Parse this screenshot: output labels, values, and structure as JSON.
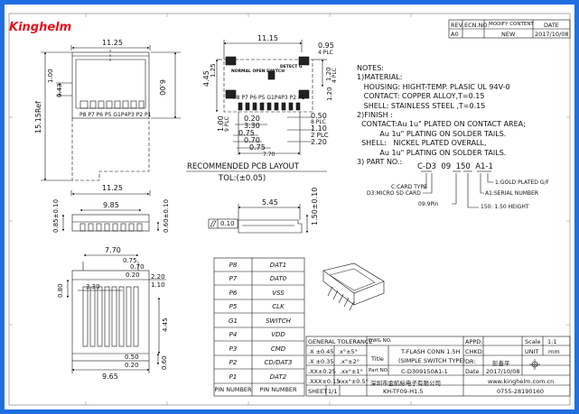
{
  "brand": {
    "logo": "Kinghelm"
  },
  "rev_table": {
    "headers": [
      "REV.",
      "ECN.NO.",
      "MODIFY CONTENT",
      "DATE"
    ],
    "row": [
      "A0",
      "",
      "NEW",
      "2017/10/08"
    ]
  },
  "dims": {
    "top_width": "11.25",
    "top_height": "6.00",
    "top_d1": "1.00",
    "top_d2": "0.43",
    "ref": "15.15Ref",
    "top_pins": "P8 P7 P6 P5 G1P4P3 P2 P1",
    "front_w1": "11.25",
    "front_w2": "9.85",
    "front_h1": "0.85±0.10",
    "front_h2": "0.60±0.10",
    "bot_w1": "7.70",
    "bot_d1": "0.75",
    "bot_d2": "0.70",
    "bot_d3": "0.20",
    "bot_d4": "2.20",
    "bot_d5": "1.10",
    "bot_d6": "3.30",
    "bot_d7": "0.80",
    "bot_d8": "4.45",
    "bot_d9": "0.50",
    "bot_d10": "0.20",
    "bot_d11": "0.60",
    "bot_w2": "9.65"
  },
  "pcb": {
    "w": "11.15",
    "d1": "0.95",
    "d1b": "4 PLC",
    "h1": "4.45",
    "h2": "1.25",
    "switch_label": "NORMAL OPEN SWITCH",
    "detect": "DETECT G",
    "r1": "1.20",
    "r1b": "4 PLC",
    "r2": "1.20",
    "pins": "P8 P7 P6 P5 G1P4P3 P2 P1",
    "b1": "0.20",
    "b2": "3.30",
    "b3": "0.75",
    "b4": "0.70",
    "b5": "0.75",
    "b6": "7.70",
    "l1": "1.00",
    "l1b": "9 PLC",
    "c1": "0.50",
    "c1b": "8 PLC",
    "c2": "1.10",
    "c3": "2 PLC",
    "c4": "2.20",
    "title": "RECOMMENDED PCB LAYOUT",
    "tol": "TOL:(±0.05)"
  },
  "side": {
    "w": "5.45",
    "h": "1.50±0.10",
    "flat": "0.10"
  },
  "notes": {
    "heading": "NOTES:",
    "lines": [
      "1)MATERIAL:",
      "   HOUSING: HIGHT-TEMP. PLASIC UL 94V-0",
      "   CONTACT: COPPER ALLOY,T=0.15",
      "   SHELL: STAINLESS STEEL ,T=0.15",
      "2)FINISH :",
      "  CONTACT:Au 1u\" PLATED ON CONTACT AREA;",
      "          Au 1u\" PLATING ON SOLDER TAILS.",
      "  SHELL:   NICKEL PLATED OVERALL,",
      "          Au 1u\" PLATING ON SOLDER TAILS.",
      "3) PART NO.:"
    ]
  },
  "partno": {
    "code": "C-D3  09  150  A1-1",
    "l1": "C:CARD TYPE",
    "l2": "D3:MICRO SD CARD",
    "l3": "09:9Pin",
    "r1": "1:GOLD PLATED G/F",
    "r2": "A1:SERIAL NUMBER",
    "r3": "150: 1.50 HEIGHT"
  },
  "pins": {
    "rows": [
      [
        "P8",
        "DAT1"
      ],
      [
        "P7",
        "DAT0"
      ],
      [
        "P6",
        "VSS"
      ],
      [
        "P5",
        "CLK"
      ],
      [
        "G1",
        "SWITCH"
      ],
      [
        "P4",
        "VDD"
      ],
      [
        "P3",
        "CMD"
      ],
      [
        "P2",
        "CD/DAT3"
      ],
      [
        "P1",
        "DAT2"
      ]
    ],
    "footer": [
      "PIN NUMBER",
      "PIN NUMBER"
    ]
  },
  "titleblock": {
    "gen_tol": "GENERAL TOLERANCE",
    "dwg_no": "DWG NO.",
    "tol_rows": [
      [
        ".X ±0.45",
        "x°±5°"
      ],
      [
        ".X ±0.35",
        ".x°±2°"
      ],
      [
        ".XX±0.25",
        ".xx°±1°"
      ],
      [
        ".XXX±0.15",
        ".xxx°±0.5°"
      ]
    ],
    "title_label": "Title",
    "title1": "T-FLASH CONN 1.5H",
    "title2": "(SIMPLE SWITCH TYPE)",
    "part_label": "Part NO.",
    "part_no": "C-D309150A1-1",
    "company": "深圳市金航标电子有限公司",
    "dwg": "KH-TF09-H1.5",
    "sheet_label": "SHEET",
    "sheet": "1/1",
    "appd": "APPD:",
    "chkd": "CHKD:",
    "dr": "DR:",
    "dr_name": "彭善平",
    "date_label": "Date",
    "date": "2017/10/08",
    "scale_label": "Scale",
    "scale": "1:1",
    "unit_label": "UNIT",
    "unit": "mm",
    "web": "www.kinghelm.com.cn",
    "phone": "0755-28190160"
  }
}
